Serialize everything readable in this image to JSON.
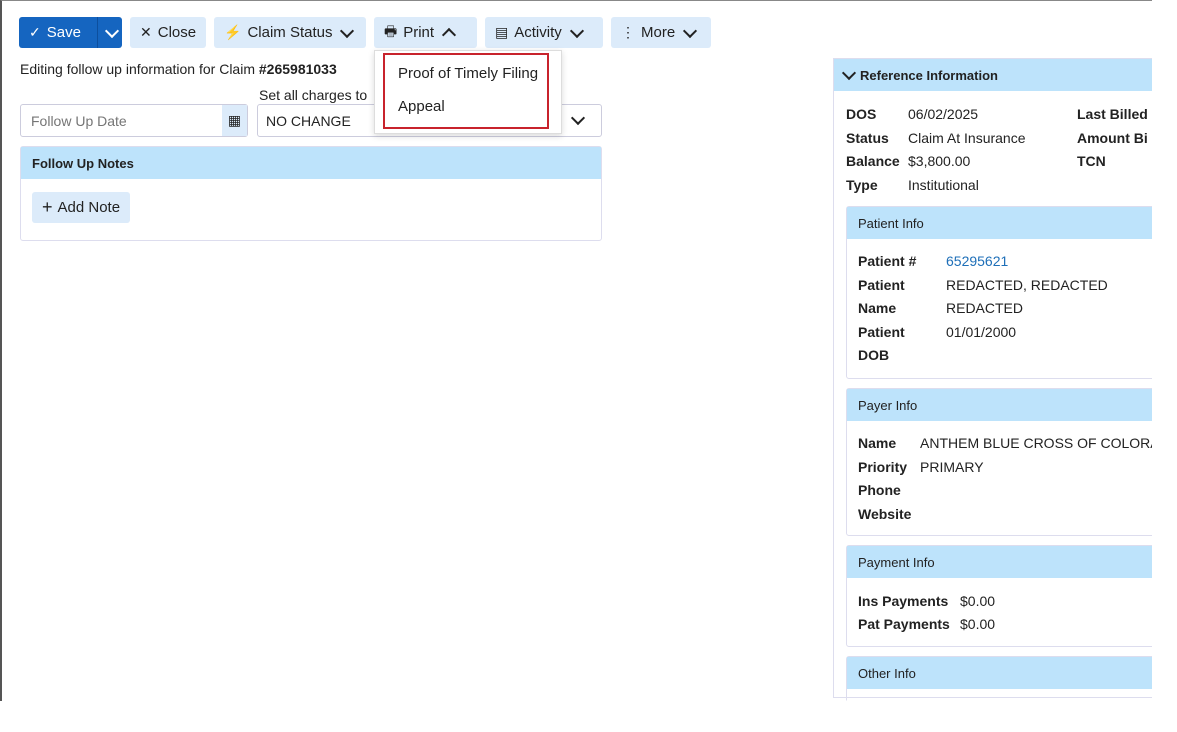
{
  "toolbar": {
    "save_label": "Save",
    "close_label": "Close",
    "claim_status_label": "Claim Status",
    "print_label": "Print",
    "activity_label": "Activity",
    "more_label": "More"
  },
  "editing": {
    "prefix": "Editing follow up information for Claim ",
    "claim_number": "#265981033"
  },
  "form": {
    "follow_up_date_placeholder": "Follow Up Date",
    "set_charges_label": "Set all charges to",
    "set_charges_value": "NO CHANGE"
  },
  "notes": {
    "header": "Follow Up Notes",
    "add_label": "Add Note"
  },
  "print_menu": {
    "items": [
      "Proof of Timely Filing",
      "Appeal"
    ]
  },
  "reference": {
    "header": "Reference Information",
    "dos_label": "DOS",
    "dos_value": "06/02/2025",
    "status_label": "Status",
    "status_value": "Claim At Insurance",
    "balance_label": "Balance",
    "balance_value": "$3,800.00",
    "type_label": "Type",
    "type_value": "Institutional",
    "last_billed_label": "Last Billed",
    "amount_billed_label": "Amount Bi",
    "tcn_label": "TCN"
  },
  "patient": {
    "header": "Patient Info",
    "num_label": "Patient #",
    "num_value": "65295621",
    "name_label_1": "Patient",
    "name_label_2": "Name",
    "name_value_1": "REDACTED, REDACTED",
    "name_value_2": "REDACTED",
    "dob_label_1": "Patient",
    "dob_label_2": "DOB",
    "dob_value": "01/01/2000"
  },
  "payer": {
    "header": "Payer Info",
    "name_label": "Name",
    "name_value": "ANTHEM BLUE CROSS OF COLORAD",
    "priority_label": "Priority",
    "priority_value": "PRIMARY",
    "phone_label": "Phone",
    "website_label": "Website"
  },
  "payment": {
    "header": "Payment Info",
    "ins_label": "Ins Payments",
    "ins_value": "$0.00",
    "pat_label": "Pat Payments",
    "pat_value": "$0.00"
  },
  "other": {
    "header": "Other Info"
  },
  "colors": {
    "primary": "#1565c0",
    "button_bg": "#dcebfa",
    "header_bg": "#bde3fb",
    "highlight": "#c8232c",
    "link": "#1e6fb8"
  }
}
